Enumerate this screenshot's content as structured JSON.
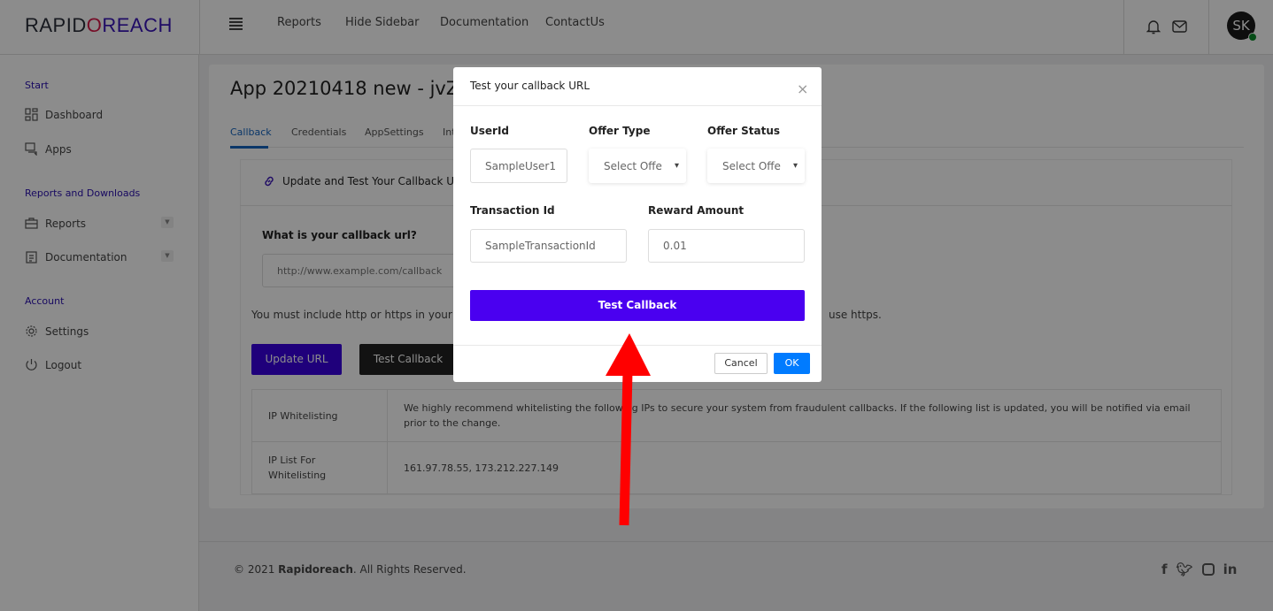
{
  "header": {
    "logo_left": "RAPID",
    "logo_mid": "O",
    "logo_right": "REACH",
    "nav": [
      "Reports",
      "Hide Sidebar",
      "Documentation",
      "ContactUs"
    ],
    "avatar_initials": "SK",
    "status_color": "#0a8a2a"
  },
  "sidebar": {
    "sections": [
      {
        "title": "Start",
        "items": [
          {
            "label": "Dashboard",
            "icon": "dashboard-icon"
          },
          {
            "label": "Apps",
            "icon": "chat-icon"
          }
        ]
      },
      {
        "title": "Reports and Downloads",
        "items": [
          {
            "label": "Reports",
            "icon": "briefcase-icon"
          },
          {
            "label": "Documentation",
            "icon": "clipboard-icon"
          }
        ]
      },
      {
        "title": "Account",
        "items": [
          {
            "label": "Settings",
            "icon": "gear-icon"
          },
          {
            "label": "Logout",
            "icon": "power-icon"
          }
        ]
      }
    ]
  },
  "main": {
    "title": "App 20210418 new - jvZjv",
    "tabs": [
      "Callback",
      "Credentials",
      "AppSettings",
      "Int"
    ],
    "card_heading": "Update and Test Your Callback U",
    "url_label": "What is your callback url?",
    "url_placeholder": "http://www.example.com/callback",
    "note_left": "You must include http or https in your pr",
    "note_right": "use https.",
    "update_button": "Update URL",
    "test_button": "Test Callback",
    "table": [
      {
        "label": "IP Whitelisting",
        "value": "We highly recommend whitelisting the following IPs to secure your system from fraudulent callbacks. If the following list is updated, you will be notified via email prior to the change."
      },
      {
        "label": "IP List For Whitelisting",
        "value": "161.97.78.55, 173.212.227.149"
      }
    ]
  },
  "footer": {
    "copy_prefix": "© 2021 ",
    "brand": "Rapidoreach",
    "copy_suffix": ". All Rights Reserved.",
    "social": [
      "facebook-icon",
      "twitter-icon",
      "instagram-icon",
      "linkedin-icon"
    ]
  },
  "modal": {
    "title": "Test your callback URL",
    "userid_label": "UserId",
    "userid_placeholder": "SampleUser1",
    "offer_type_label": "Offer Type",
    "offer_type_value": "Select Offe",
    "offer_status_label": "Offer Status",
    "offer_status_value": "Select Offe",
    "txn_label": "Transaction Id",
    "txn_placeholder": "SampleTransactionId",
    "reward_label": "Reward Amount",
    "reward_value": "0.01",
    "test_button": "Test Callback",
    "cancel": "Cancel",
    "ok": "OK",
    "accent": "#4a00f0"
  }
}
